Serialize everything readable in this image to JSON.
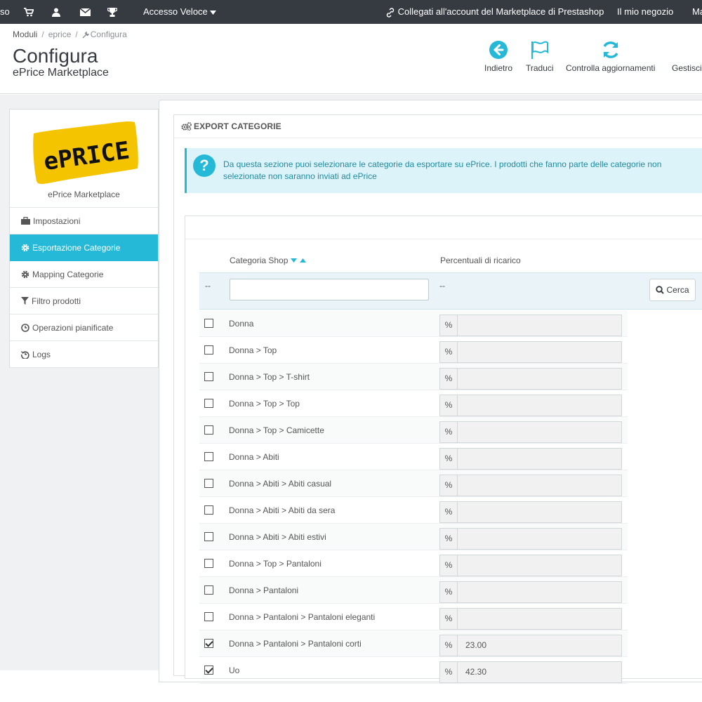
{
  "topbar": {
    "left_fragment": "so",
    "quick_access": "Accesso Veloce",
    "marketplace_link": "Collegati all'account del Marketplace di Prestashop",
    "my_shop": "Il mio negozio",
    "right_fragment": "Ma"
  },
  "breadcrumb": {
    "modules": "Moduli",
    "module": "eprice",
    "current": "Configura",
    "separator": "/"
  },
  "header": {
    "title": "Configura",
    "subtitle": "ePrice Marketplace",
    "toolbar": {
      "back": "Indietro",
      "translate": "Traduci",
      "check_updates": "Controlla aggiornamenti",
      "manage": "Gestisci"
    }
  },
  "sidebar": {
    "logo_text": "ePRICE",
    "logo_caption": "ePrice Marketplace",
    "items": [
      {
        "label": "Impostazioni",
        "icon": "briefcase-icon",
        "active": false
      },
      {
        "label": "Esportazione Categorie",
        "icon": "gear-icon",
        "active": true
      },
      {
        "label": "Mapping Categorie",
        "icon": "gear-icon",
        "active": false
      },
      {
        "label": "Filtro prodotti",
        "icon": "filter-icon",
        "active": false
      },
      {
        "label": "Operazioni pianificate",
        "icon": "clock-icon",
        "active": false
      },
      {
        "label": "Logs",
        "icon": "history-icon",
        "active": false
      }
    ]
  },
  "panel": {
    "header": "EXPORT CATEGORIE",
    "alert": "Da questa sezione puoi selezionare le categorie da esportare su ePrice. I prodotti che fanno parte delle categorie non selezionate non saranno inviati ad ePrice"
  },
  "table": {
    "col_category": "Categoria Shop",
    "col_percent": "Percentuali di ricarico",
    "filter_dash_1": "--",
    "filter_dash_2": "--",
    "search_label": "Cerca",
    "addon": "%",
    "rows": [
      {
        "name": "Donna",
        "checked": false,
        "value": ""
      },
      {
        "name": "Donna > Top",
        "checked": false,
        "value": ""
      },
      {
        "name": "Donna > Top > T-shirt",
        "checked": false,
        "value": ""
      },
      {
        "name": "Donna > Top > Top",
        "checked": false,
        "value": ""
      },
      {
        "name": "Donna > Top > Camicette",
        "checked": false,
        "value": ""
      },
      {
        "name": "Donna > Abiti",
        "checked": false,
        "value": ""
      },
      {
        "name": "Donna > Abiti > Abiti casual",
        "checked": false,
        "value": ""
      },
      {
        "name": "Donna > Abiti > Abiti da sera",
        "checked": false,
        "value": ""
      },
      {
        "name": "Donna > Abiti > Abiti estivi",
        "checked": false,
        "value": ""
      },
      {
        "name": "Donna > Top > Pantaloni",
        "checked": false,
        "value": ""
      },
      {
        "name": "Donna > Pantaloni",
        "checked": false,
        "value": ""
      },
      {
        "name": "Donna > Pantaloni > Pantaloni eleganti",
        "checked": false,
        "value": ""
      },
      {
        "name": "Donna > Pantaloni > Pantaloni corti",
        "checked": true,
        "value": "23.00"
      },
      {
        "name": "Uo",
        "checked": true,
        "value": "42.30"
      }
    ]
  },
  "colors": {
    "accent": "#25b9d7",
    "topbar": "#363a41",
    "logo_yellow": "#f5c400"
  }
}
